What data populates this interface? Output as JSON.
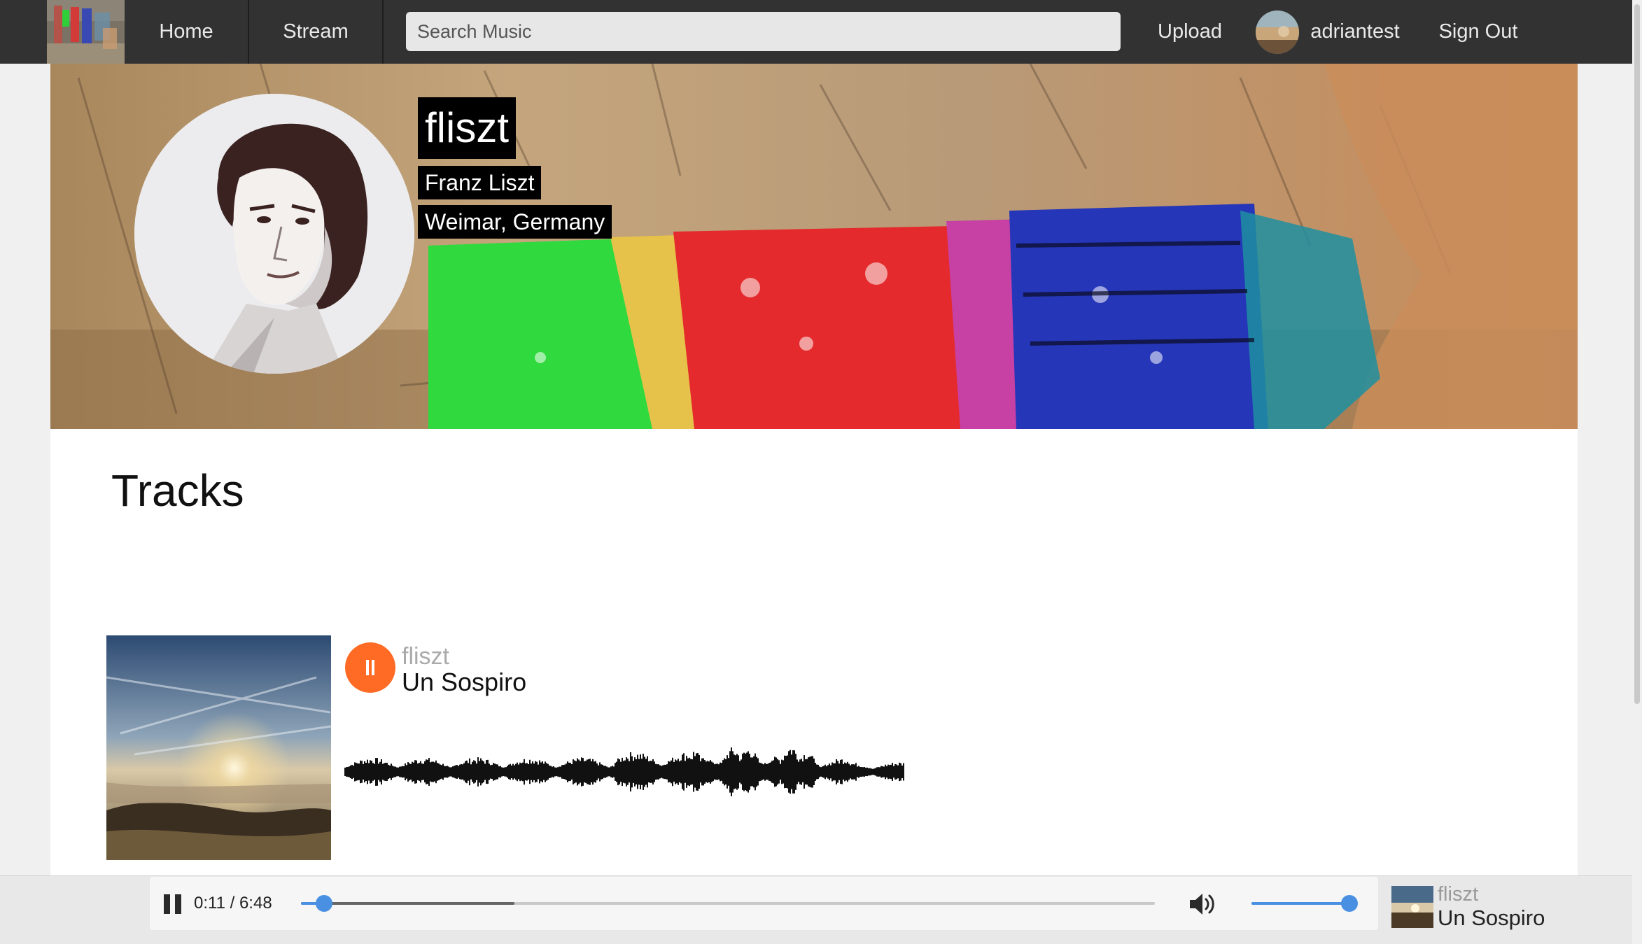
{
  "nav": {
    "home_label": "Home",
    "stream_label": "Stream",
    "search_placeholder": "Search Music",
    "upload_label": "Upload",
    "username": "adriantest",
    "signout_label": "Sign Out"
  },
  "profile": {
    "username": "fliszt",
    "full_name": "Franz Liszt",
    "location": "Weimar, Germany"
  },
  "tracks_section": {
    "title": "Tracks",
    "items": [
      {
        "artist": "fliszt",
        "title": "Un Sospiro",
        "state": "playing"
      }
    ]
  },
  "player": {
    "current_time": "0:11",
    "separator": "/",
    "duration": "6:48",
    "progress_fraction": 0.027,
    "buffered_fraction": 0.25,
    "volume_fraction": 1.0,
    "now_playing_artist": "fliszt",
    "now_playing_title": "Un Sospiro"
  },
  "colors": {
    "navbar": "#323232",
    "play_button": "#ff6a24",
    "accent": "#4a90e2"
  },
  "icons": {
    "play_toggle": "pause-icon",
    "volume": "speaker-icon"
  }
}
